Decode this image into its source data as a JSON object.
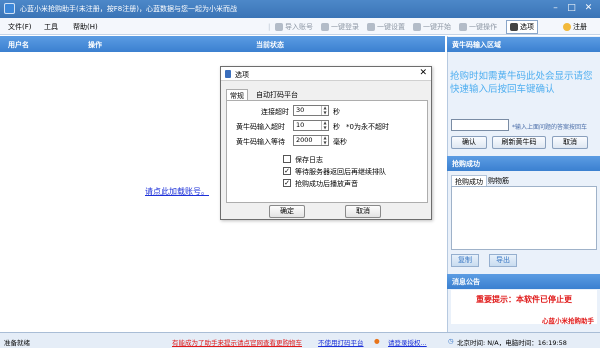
{
  "window": {
    "title": "心蓝小米抢购助手(未注册，按F8注册)，心蓝数据与您一起为小米而战"
  },
  "menu": [
    "文件(F)",
    "工具",
    "帮助(H)"
  ],
  "toolbar": {
    "import": "导入账号",
    "login": "一键登录",
    "settings": "一键设置",
    "start": "一键开始",
    "operate": "一键操作",
    "options": "选项",
    "register": "注册"
  },
  "grid": {
    "col_user": "用户名",
    "col_action": "操作",
    "col_status": "当前状态",
    "add_link": "请点此加载账号。"
  },
  "right": {
    "code_header": "黄牛码输入区域",
    "code_hint_text": "抢购时如需黄牛码此处会显示请您快速输入后按回车键确认",
    "input_hint": "*输入上面问题的答案按回车",
    "btn_confirm": "确认",
    "btn_refresh": "刷新黄牛码",
    "btn_cancel": "取消",
    "success_header": "抢购成功",
    "tab_success": "抢购成功",
    "tab_buy": "购物筋",
    "btn_copy": "复制",
    "btn_export": "导出",
    "notice_header": "消息公告",
    "notice_main": "重要提示：本软件已停止更",
    "notice_sign": "心蓝小米抢购助手"
  },
  "dialog": {
    "title": "选项",
    "tab_general": "常规",
    "tab_captcha": "自动打码平台",
    "conn_label": "连接超时",
    "conn_value": "30",
    "conn_unit": "秒",
    "input_label": "黄牛码输入超时",
    "input_value": "10",
    "input_unit": "秒",
    "input_note": "*0为永不超时",
    "wait_label": "黄牛码输入等待",
    "wait_value": "2000",
    "wait_unit": "毫秒",
    "opt_log": "保存日志",
    "opt_requeue": "等待服务器返回后再继续排队",
    "opt_sound": "抢购成功后播放声音",
    "btn_ok": "确定",
    "btn_cancel": "取消"
  },
  "status": {
    "ready": "准备就绪",
    "link1": "有能成为了助手来提示请点官网查看更购物车",
    "link2": "不使用打码平台",
    "link3": "请登录授权...",
    "clock": "北京时间: N/A，电脑时间：16:19:58"
  }
}
